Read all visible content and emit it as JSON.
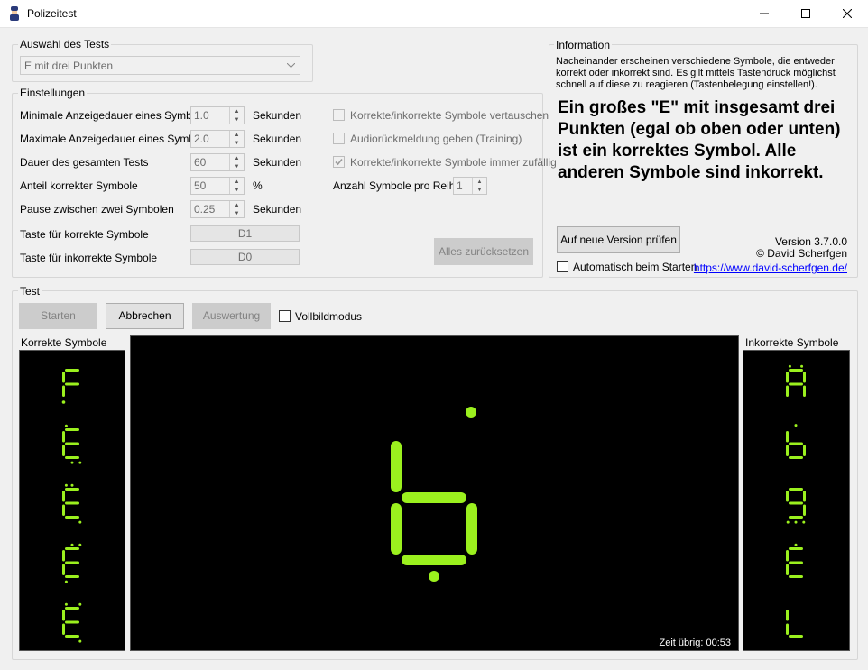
{
  "window": {
    "title": "Polizeitest"
  },
  "test_selection": {
    "group_label": "Auswahl des Tests",
    "selected_test": "E mit drei Punkten"
  },
  "settings": {
    "group_label": "Einstellungen",
    "min_display": {
      "label": "Minimale Anzeigedauer eines Symbols",
      "value": "1.0",
      "unit": "Sekunden"
    },
    "max_display": {
      "label": "Maximale Anzeigedauer eines Symbols",
      "value": "2.0",
      "unit": "Sekunden"
    },
    "total_duration": {
      "label": "Dauer des gesamten Tests",
      "value": "60",
      "unit": "Sekunden"
    },
    "correct_ratio": {
      "label": "Anteil korrekter Symbole",
      "value": "50",
      "unit": "%"
    },
    "pause": {
      "label": "Pause zwischen zwei Symbolen",
      "value": "0.25",
      "unit": "Sekunden"
    },
    "key_correct": {
      "label": "Taste für korrekte Symbole",
      "value": "D1"
    },
    "key_incorrect": {
      "label": "Taste für inkorrekte Symbole",
      "value": "D0"
    },
    "swap_symbols": {
      "label": "Korrekte/inkorrekte Symbole vertauschen",
      "checked": false
    },
    "audio_feedback": {
      "label": "Audiorückmeldung geben (Training)",
      "checked": false
    },
    "always_random": {
      "label": "Korrekte/inkorrekte Symbole immer zufällig",
      "checked": true
    },
    "symbols_per_row": {
      "label": "Anzahl Symbole pro Reihe",
      "value": "1"
    },
    "reset_button": "Alles zurücksetzen"
  },
  "information": {
    "group_label": "Information",
    "description": "Nacheinander erscheinen verschiedene Symbole, die entweder korrekt oder inkorrekt sind. Es gilt mittels Tastendruck möglichst schnell auf diese zu reagieren (Tastenbelegung einstellen!).",
    "headline": "Ein großes \"E\" mit insgesamt drei Punkten (egal ob oben oder unten) ist ein korrektes Symbol. Alle anderen Symbole sind inkorrekt.",
    "check_version_button": "Auf neue Version prüfen",
    "auto_check_label": "Automatisch beim Starten",
    "version": "Version 3.7.0.0",
    "author": "© David Scherfgen",
    "website": "https://www.david-scherfgen.de/"
  },
  "test": {
    "group_label": "Test",
    "start_button": "Starten",
    "cancel_button": "Abbrechen",
    "evaluation_button": "Auswertung",
    "fullscreen_label": "Vollbildmodus",
    "correct_panel_label": "Korrekte Symbole",
    "incorrect_panel_label": "Inkorrekte Symbole",
    "time_left": "Zeit übrig: 00:53",
    "correct_symbols": [
      "F.",
      "E",
      "E",
      "E",
      "E"
    ],
    "incorrect_symbols": [
      "A",
      "b",
      "9",
      "E",
      "L"
    ],
    "current_symbol": "b"
  },
  "colors": {
    "segment": "#9bf01e",
    "segment_glow": "#5a9a00",
    "display_bg": "#000000"
  }
}
